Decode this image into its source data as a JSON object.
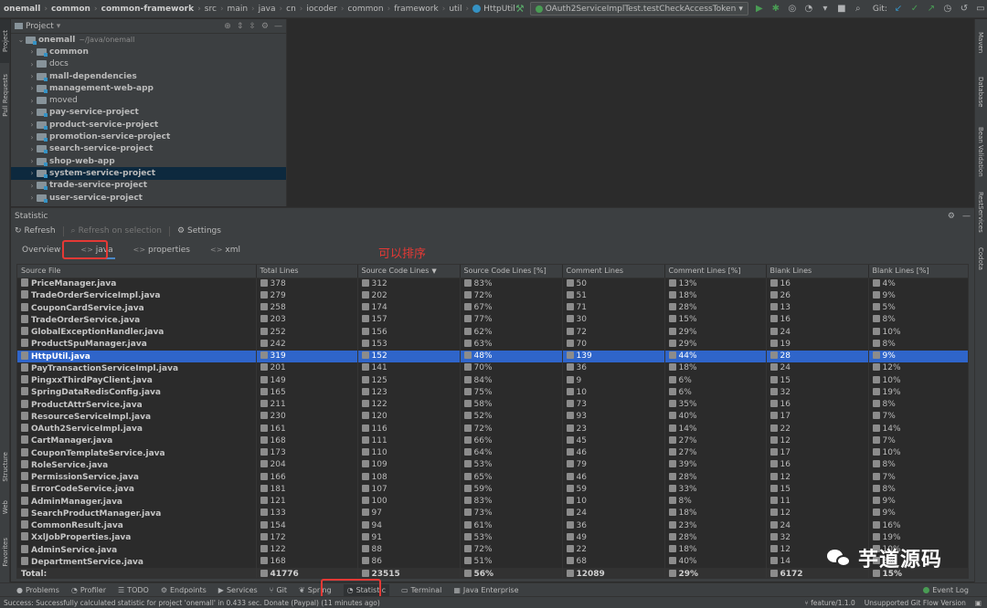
{
  "breadcrumbs": [
    "onemall",
    "common",
    "common-framework",
    "src",
    "main",
    "java",
    "cn",
    "iocoder",
    "common",
    "framework",
    "util",
    "HttpUtil"
  ],
  "run_config": "OAuth2ServiceImplTest.testCheckAccessToken",
  "git_label": "Git:",
  "left_stripe": {
    "project": "Project",
    "pull_requests": "Pull Requests",
    "structure": "Structure",
    "web": "Web",
    "favorites": "Favorites"
  },
  "right_stripe": {
    "maven": "Maven",
    "database": "Database",
    "bean_validation": "Bean Validation",
    "rest_services": "RestServices",
    "codota": "Codota"
  },
  "project_panel": {
    "title": "Project",
    "tree": [
      {
        "name": "onemall",
        "path": "~/Java/onemall",
        "level": 0,
        "expanded": true,
        "module": true
      },
      {
        "name": "common",
        "level": 1,
        "module": true
      },
      {
        "name": "docs",
        "level": 1,
        "plain": true
      },
      {
        "name": "mall-dependencies",
        "level": 1,
        "module": true
      },
      {
        "name": "management-web-app",
        "level": 1,
        "module": true
      },
      {
        "name": "moved",
        "level": 1,
        "plain": true
      },
      {
        "name": "pay-service-project",
        "level": 1,
        "module": true
      },
      {
        "name": "product-service-project",
        "level": 1,
        "module": true
      },
      {
        "name": "promotion-service-project",
        "level": 1,
        "module": true
      },
      {
        "name": "search-service-project",
        "level": 1,
        "module": true
      },
      {
        "name": "shop-web-app",
        "level": 1,
        "module": true
      },
      {
        "name": "system-service-project",
        "level": 1,
        "module": true,
        "selected": true
      },
      {
        "name": "trade-service-project",
        "level": 1,
        "module": true
      },
      {
        "name": "user-service-project",
        "level": 1,
        "module": true
      }
    ]
  },
  "statistic": {
    "title": "Statistic",
    "toolbar": {
      "refresh": "Refresh",
      "refresh_on_selection": "Refresh on selection",
      "settings": "Settings"
    },
    "tabs": [
      {
        "label": "Overview",
        "tag": ""
      },
      {
        "label": "java",
        "tag": "<>",
        "active": true
      },
      {
        "label": "properties",
        "tag": "<>"
      },
      {
        "label": "xml",
        "tag": "<>"
      }
    ],
    "annotation": "可以排序",
    "columns": [
      "Source File",
      "Total Lines",
      "Source Code Lines",
      "Source Code Lines [%]",
      "Comment Lines",
      "Comment Lines [%]",
      "Blank Lines",
      "Blank Lines [%]"
    ],
    "rows": [
      [
        "PriceManager.java",
        "378",
        "312",
        "83%",
        "50",
        "13%",
        "16",
        "4%"
      ],
      [
        "TradeOrderServiceImpl.java",
        "279",
        "202",
        "72%",
        "51",
        "18%",
        "26",
        "9%"
      ],
      [
        "CouponCardService.java",
        "258",
        "174",
        "67%",
        "71",
        "28%",
        "13",
        "5%"
      ],
      [
        "TradeOrderService.java",
        "203",
        "157",
        "77%",
        "30",
        "15%",
        "16",
        "8%"
      ],
      [
        "GlobalExceptionHandler.java",
        "252",
        "156",
        "62%",
        "72",
        "29%",
        "24",
        "10%"
      ],
      [
        "ProductSpuManager.java",
        "242",
        "153",
        "63%",
        "70",
        "29%",
        "19",
        "8%"
      ],
      [
        "HttpUtil.java",
        "319",
        "152",
        "48%",
        "139",
        "44%",
        "28",
        "9%"
      ],
      [
        "PayTransactionServiceImpl.java",
        "201",
        "141",
        "70%",
        "36",
        "18%",
        "24",
        "12%"
      ],
      [
        "PingxxThirdPayClient.java",
        "149",
        "125",
        "84%",
        "9",
        "6%",
        "15",
        "10%"
      ],
      [
        "SpringDataRedisConfig.java",
        "165",
        "123",
        "75%",
        "10",
        "6%",
        "32",
        "19%"
      ],
      [
        "ProductAttrService.java",
        "211",
        "122",
        "58%",
        "73",
        "35%",
        "16",
        "8%"
      ],
      [
        "ResourceServiceImpl.java",
        "230",
        "120",
        "52%",
        "93",
        "40%",
        "17",
        "7%"
      ],
      [
        "OAuth2ServiceImpl.java",
        "161",
        "116",
        "72%",
        "23",
        "14%",
        "22",
        "14%"
      ],
      [
        "CartManager.java",
        "168",
        "111",
        "66%",
        "45",
        "27%",
        "12",
        "7%"
      ],
      [
        "CouponTemplateService.java",
        "173",
        "110",
        "64%",
        "46",
        "27%",
        "17",
        "10%"
      ],
      [
        "RoleService.java",
        "204",
        "109",
        "53%",
        "79",
        "39%",
        "16",
        "8%"
      ],
      [
        "PermissionService.java",
        "166",
        "108",
        "65%",
        "46",
        "28%",
        "12",
        "7%"
      ],
      [
        "ErrorCodeService.java",
        "181",
        "107",
        "59%",
        "59",
        "33%",
        "15",
        "8%"
      ],
      [
        "AdminManager.java",
        "121",
        "100",
        "83%",
        "10",
        "8%",
        "11",
        "9%"
      ],
      [
        "SearchProductManager.java",
        "133",
        "97",
        "73%",
        "24",
        "18%",
        "12",
        "9%"
      ],
      [
        "CommonResult.java",
        "154",
        "94",
        "61%",
        "36",
        "23%",
        "24",
        "16%"
      ],
      [
        "XxlJobProperties.java",
        "172",
        "91",
        "53%",
        "49",
        "28%",
        "32",
        "19%"
      ],
      [
        "AdminService.java",
        "122",
        "88",
        "72%",
        "22",
        "18%",
        "12",
        "10%"
      ],
      [
        "DepartmentService.java",
        "168",
        "86",
        "51%",
        "68",
        "40%",
        "14",
        "8%"
      ]
    ],
    "selected_row": 6,
    "sorted_column": 2,
    "total": [
      "Total:",
      "41776",
      "23515",
      "56%",
      "12089",
      "29%",
      "6172",
      "15%"
    ]
  },
  "bottom_bar": {
    "items": [
      {
        "label": "Problems",
        "icon": "problems-icon",
        "glyph": "●"
      },
      {
        "label": "Profiler",
        "icon": "profiler-icon",
        "glyph": "◔"
      },
      {
        "label": "TODO",
        "icon": "todo-icon",
        "glyph": "☰"
      },
      {
        "label": "Endpoints",
        "icon": "endpoints-icon",
        "glyph": "⚙"
      },
      {
        "label": "Services",
        "icon": "services-icon",
        "glyph": "▶"
      },
      {
        "label": "Git",
        "icon": "git-icon",
        "glyph": "⑂"
      },
      {
        "label": "Spring",
        "icon": "spring-icon",
        "glyph": "❦"
      },
      {
        "label": "Statistic",
        "icon": "statistic-icon",
        "glyph": "◔",
        "active": true
      },
      {
        "label": "Terminal",
        "icon": "terminal-icon",
        "glyph": "▭"
      },
      {
        "label": "Java Enterprise",
        "icon": "java-enterprise-icon",
        "glyph": "▦"
      }
    ],
    "event_log": "Event Log"
  },
  "status_bar": {
    "message": "Success: Successfully calculated statistic for project 'onemall' in 0.433 sec. Donate (Paypal) (11 minutes ago)",
    "branch": "feature/1.1.0",
    "git_flow": "Unsupported Git Flow Version"
  },
  "watermark": "芋道源码",
  "colors": {
    "accent": "#2f65ca",
    "highlight": "#e53935",
    "background": "#2b2b2b",
    "panel": "#3c3f41"
  }
}
